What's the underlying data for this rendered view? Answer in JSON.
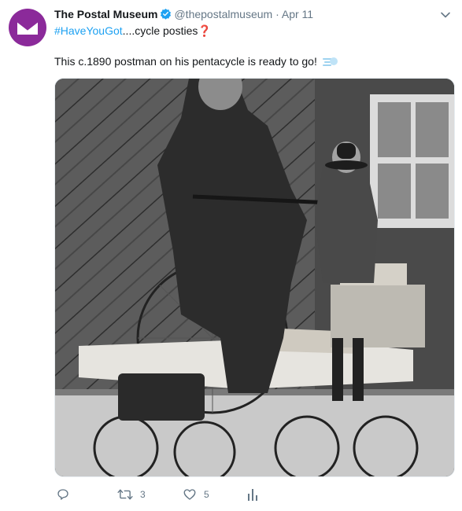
{
  "tweet": {
    "display_name": "The Postal Museum",
    "handle": "@thepostalmuseum",
    "separator": "·",
    "time": "Apr 11",
    "hashtag": "#HaveYouGot",
    "line2_suffix": "....cycle posties",
    "line2_emoji": "❓",
    "body": "This c.1890 postman on his pentacycle is ready to go!",
    "body_emoji": "💨",
    "replies": "",
    "retweets": "3",
    "likes": "5"
  },
  "colors": {
    "brand": "#8b2a9a",
    "link": "#1da1f2",
    "muted": "#657786",
    "verified": "#1da1f2",
    "question": "#dd2e44"
  },
  "icons": [
    "mail-logo-icon",
    "verified-badge-icon",
    "chevron-down-icon",
    "reply-icon",
    "retweet-icon",
    "like-icon",
    "analytics-icon",
    "dash-icon"
  ]
}
